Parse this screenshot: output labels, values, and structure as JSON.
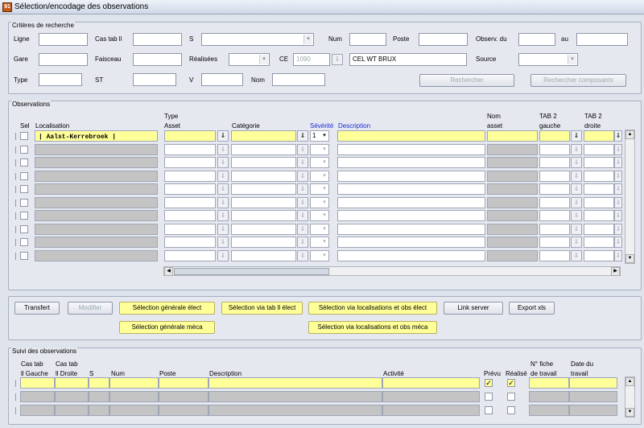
{
  "window": {
    "title": "Sélection/encodage des observations",
    "icon": "app-icon-91"
  },
  "criteria": {
    "title": "Critères de recherche",
    "labels": {
      "ligne": "Ligne",
      "cas_tab": "Cas tab ll",
      "s": "S",
      "num": "Num",
      "poste": "Poste",
      "observ_du": "Observ. du",
      "au": "au",
      "gare": "Gare",
      "faisceau": "Faisceau",
      "realisees": "Réalisées",
      "ce": "CE",
      "source": "Source",
      "type": "Type",
      "st": "ST",
      "v": "V",
      "nom": "Nom"
    },
    "ce_value": "1090",
    "ce_name": "CEL WT BRUX",
    "buttons": {
      "rechercher": "Rechercher",
      "rechercher_composants": "Rechercher composants"
    }
  },
  "observations": {
    "title": "Observations",
    "headers": {
      "sel": "Sel",
      "localisation": "Localisation",
      "type_asset_1": "Type",
      "type_asset_2": "Asset",
      "categorie": "Catégorie",
      "severite": "Sévérité",
      "description": "Description",
      "nom_asset_1": "Nom",
      "nom_asset_2": "asset",
      "tab2g_1": "TAB 2",
      "tab2g_2": "gauche",
      "tab2d_1": "TAB 2",
      "tab2d_2": "droite"
    },
    "first_row": {
      "localisation": "| Aalst-Kerrebroek |",
      "severite": "1"
    },
    "row_count": 10
  },
  "actions": {
    "transfert": "Transfert",
    "modifier": "Modifier",
    "sel_gen_elect": "Sélection générale élect",
    "sel_tab_elect": "Sélection via tab ll élect",
    "sel_loc_elect": "Sélection via localisations et obs élect",
    "link_server": "Link server",
    "export_xls": "Export xls",
    "sel_gen_meca": "Sélection générale méca",
    "sel_loc_meca": "Sélection via localisations et obs méca"
  },
  "suivi": {
    "title": "Suivi des observations",
    "headers": {
      "cas_tab_g_1": "Cas tab",
      "cas_tab_g_2": "ll Gauche",
      "cas_tab_d_1": "Cas tab",
      "cas_tab_d_2": "ll Droite",
      "s": "S",
      "num": "Num",
      "poste": "Poste",
      "description": "Description",
      "activite": "Activité",
      "prevu": "Prévu",
      "realise": "Réalisé",
      "fiche_1": "N° fiche",
      "fiche_2": "de travail",
      "date_1": "Date du",
      "date_2": "travail"
    },
    "row_count": 3
  },
  "colors": {
    "highlight": "#ffff99",
    "disabled_cell": "#c4c4c4",
    "background": "#dfe3ec",
    "link_blue": "#1a2bd6"
  }
}
